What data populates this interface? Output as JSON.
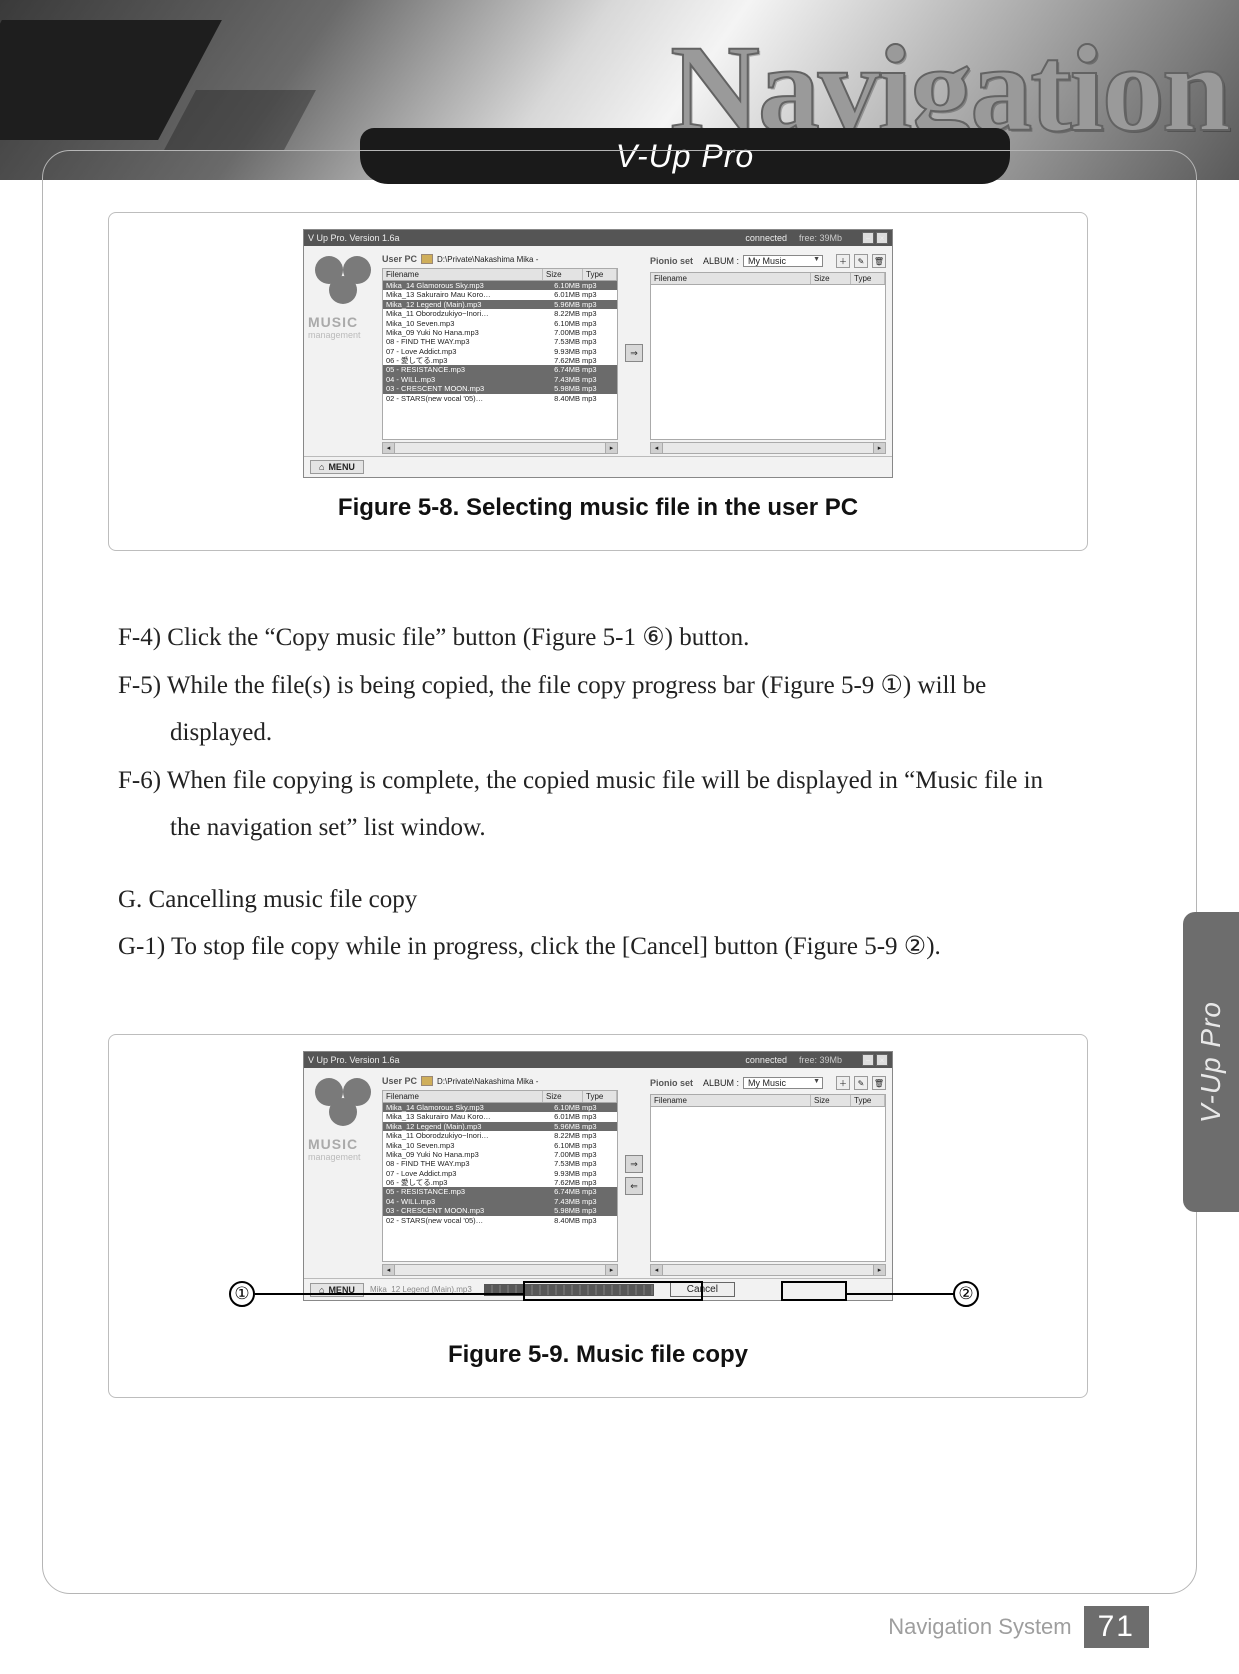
{
  "header": {
    "bg_word": "Navigation",
    "tab_title": "V-Up Pro",
    "side_tab": "V-Up Pro"
  },
  "figure1": {
    "caption": "Figure 5-8. Selecting music file in the user PC",
    "app": {
      "title": "V Up Pro. Version 1.6a",
      "status": "connected",
      "mem": "free: 39Mb",
      "user_pc_label": "User PC",
      "path": "D:\\Private\\Nakashima Mika -",
      "col_filename": "Filename",
      "col_size": "Size",
      "col_type": "Type",
      "pionio_label": "Pionio set",
      "album_label": "ALBUM :",
      "album_value": "My Music",
      "menu_btn": "MENU",
      "rows": [
        {
          "fn": "Mika_14 Glamorous Sky.mp3",
          "sz": "6.10MB",
          "ty": "mp3",
          "sel": true
        },
        {
          "fn": "Mika_13 Sakurairo Mau Koro…",
          "sz": "6.01MB",
          "ty": "mp3",
          "sel": false
        },
        {
          "fn": "Mika_12 Legend (Main).mp3",
          "sz": "5.96MB",
          "ty": "mp3",
          "sel": true
        },
        {
          "fn": "Mika_11 Oborodzukiyo~Inori…",
          "sz": "8.22MB",
          "ty": "mp3",
          "sel": false
        },
        {
          "fn": "Mika_10 Seven.mp3",
          "sz": "6.10MB",
          "ty": "mp3",
          "sel": false
        },
        {
          "fn": "Mika_09 Yuki No Hana.mp3",
          "sz": "7.00MB",
          "ty": "mp3",
          "sel": false
        },
        {
          "fn": "08 - FIND THE WAY.mp3",
          "sz": "7.53MB",
          "ty": "mp3",
          "sel": false
        },
        {
          "fn": "07 - Love Addict.mp3",
          "sz": "9.93MB",
          "ty": "mp3",
          "sel": false
        },
        {
          "fn": "06 - 愛してる.mp3",
          "sz": "7.62MB",
          "ty": "mp3",
          "sel": false
        },
        {
          "fn": "05 - RESISTANCE.mp3",
          "sz": "6.74MB",
          "ty": "mp3",
          "sel": true
        },
        {
          "fn": "04 - WILL.mp3",
          "sz": "7.43MB",
          "ty": "mp3",
          "sel": true
        },
        {
          "fn": "03 - CRESCENT MOON.mp3",
          "sz": "5.98MB",
          "ty": "mp3",
          "sel": true
        },
        {
          "fn": "02 - STARS(new vocal '05)…",
          "sz": "8.40MB",
          "ty": "mp3",
          "sel": false
        }
      ]
    }
  },
  "body": {
    "f4": "F-4) Click the “Copy music file” button (Figure 5-1 ⑥) button.",
    "f5a": "F-5) While the file(s) is being copied, the file copy progress bar (Figure 5-9 ①) will be",
    "f5b": "displayed.",
    "f6a": "F-6) When file copying is complete, the copied music file will be displayed in “Music file in",
    "f6b": "the navigation set” list window.",
    "g": "G. Cancelling music file copy",
    "g1": "G-1) To stop file copy while in progress, click the [Cancel] button (Figure 5-9 ②)."
  },
  "figure2": {
    "caption": "Figure 5-9. Music file copy",
    "callout1": "①",
    "callout2": "②",
    "cancel": "Cancel",
    "copying_file": "Mika_12 Legend (Main).mp3"
  },
  "footer": {
    "label": "Navigation System",
    "page": "71"
  }
}
